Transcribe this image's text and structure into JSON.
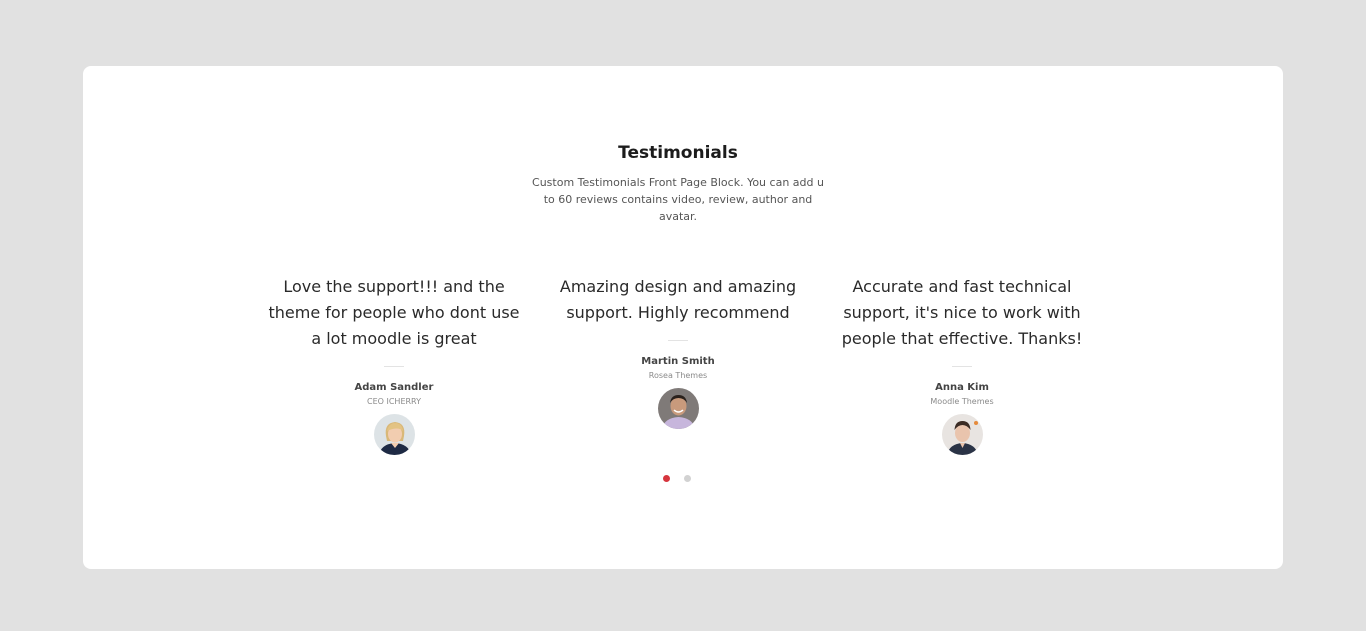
{
  "section": {
    "title": "Testimonials",
    "description": "Custom Testimonials Front Page Block. You can add u to 60 reviews contains video, review, author and avatar."
  },
  "testimonials": [
    {
      "quote": "Love the support!!! and the theme for people who dont use a lot moodle is great",
      "author": "Adam Sandler",
      "role": "CEO ICHERRY",
      "avatar_icon": "avatar-woman-blonde"
    },
    {
      "quote": "Amazing design and amazing support. Highly recommend",
      "author": "Martin Smith",
      "role": "Rosea Themes",
      "avatar_icon": "avatar-man-smiling"
    },
    {
      "quote": "Accurate and fast technical support, it's nice to work with people that effective. Thanks!",
      "author": "Anna Kim",
      "role": "Moodle Themes",
      "avatar_icon": "avatar-man-dark-hair"
    }
  ],
  "pagination": {
    "pages": 2,
    "active_page": 1,
    "active_color": "#d6353e",
    "inactive_color": "#d2d2d2"
  }
}
